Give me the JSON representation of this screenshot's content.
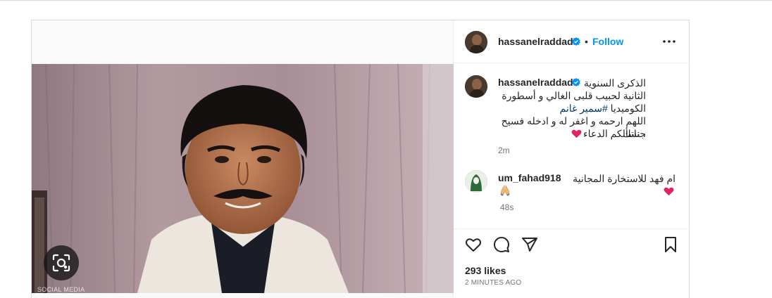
{
  "post": {
    "author": "hassanelraddad",
    "follow_label": "Follow",
    "separator": "•",
    "caption_line1": "الذكرى السنوية",
    "caption_line2": "الثانية لحبيب قلبى الغالي و أسطورة",
    "caption_line3_pre": "الكوميديا ",
    "caption_hashtag": "#سمير غانم",
    "caption_line4": "اللهم ارحمه و اغفر له و ادخله فسيح جناتك",
    "caption_line5": "، نسألكم الدعاء",
    "caption_time": "2m",
    "watermark": "SOCIAL MEDIA",
    "likes": "293 likes",
    "posted_ago": "2 MINUTES AGO"
  },
  "comments": [
    {
      "user": "um_fahad918",
      "text": "ام فهد للاستخارة المجانية",
      "time": "48s"
    }
  ],
  "colors": {
    "accent": "#0095f6",
    "verified": "#0095f6",
    "heart": "#e0245e",
    "text": "#262626",
    "muted": "#737373"
  },
  "icons": [
    "verified-badge-icon",
    "more-options-icon",
    "visual-search-icon",
    "heart-emoji-icon",
    "pray-emoji-icon",
    "like-heart-icon",
    "comment-icon",
    "share-icon",
    "save-bookmark-icon"
  ]
}
